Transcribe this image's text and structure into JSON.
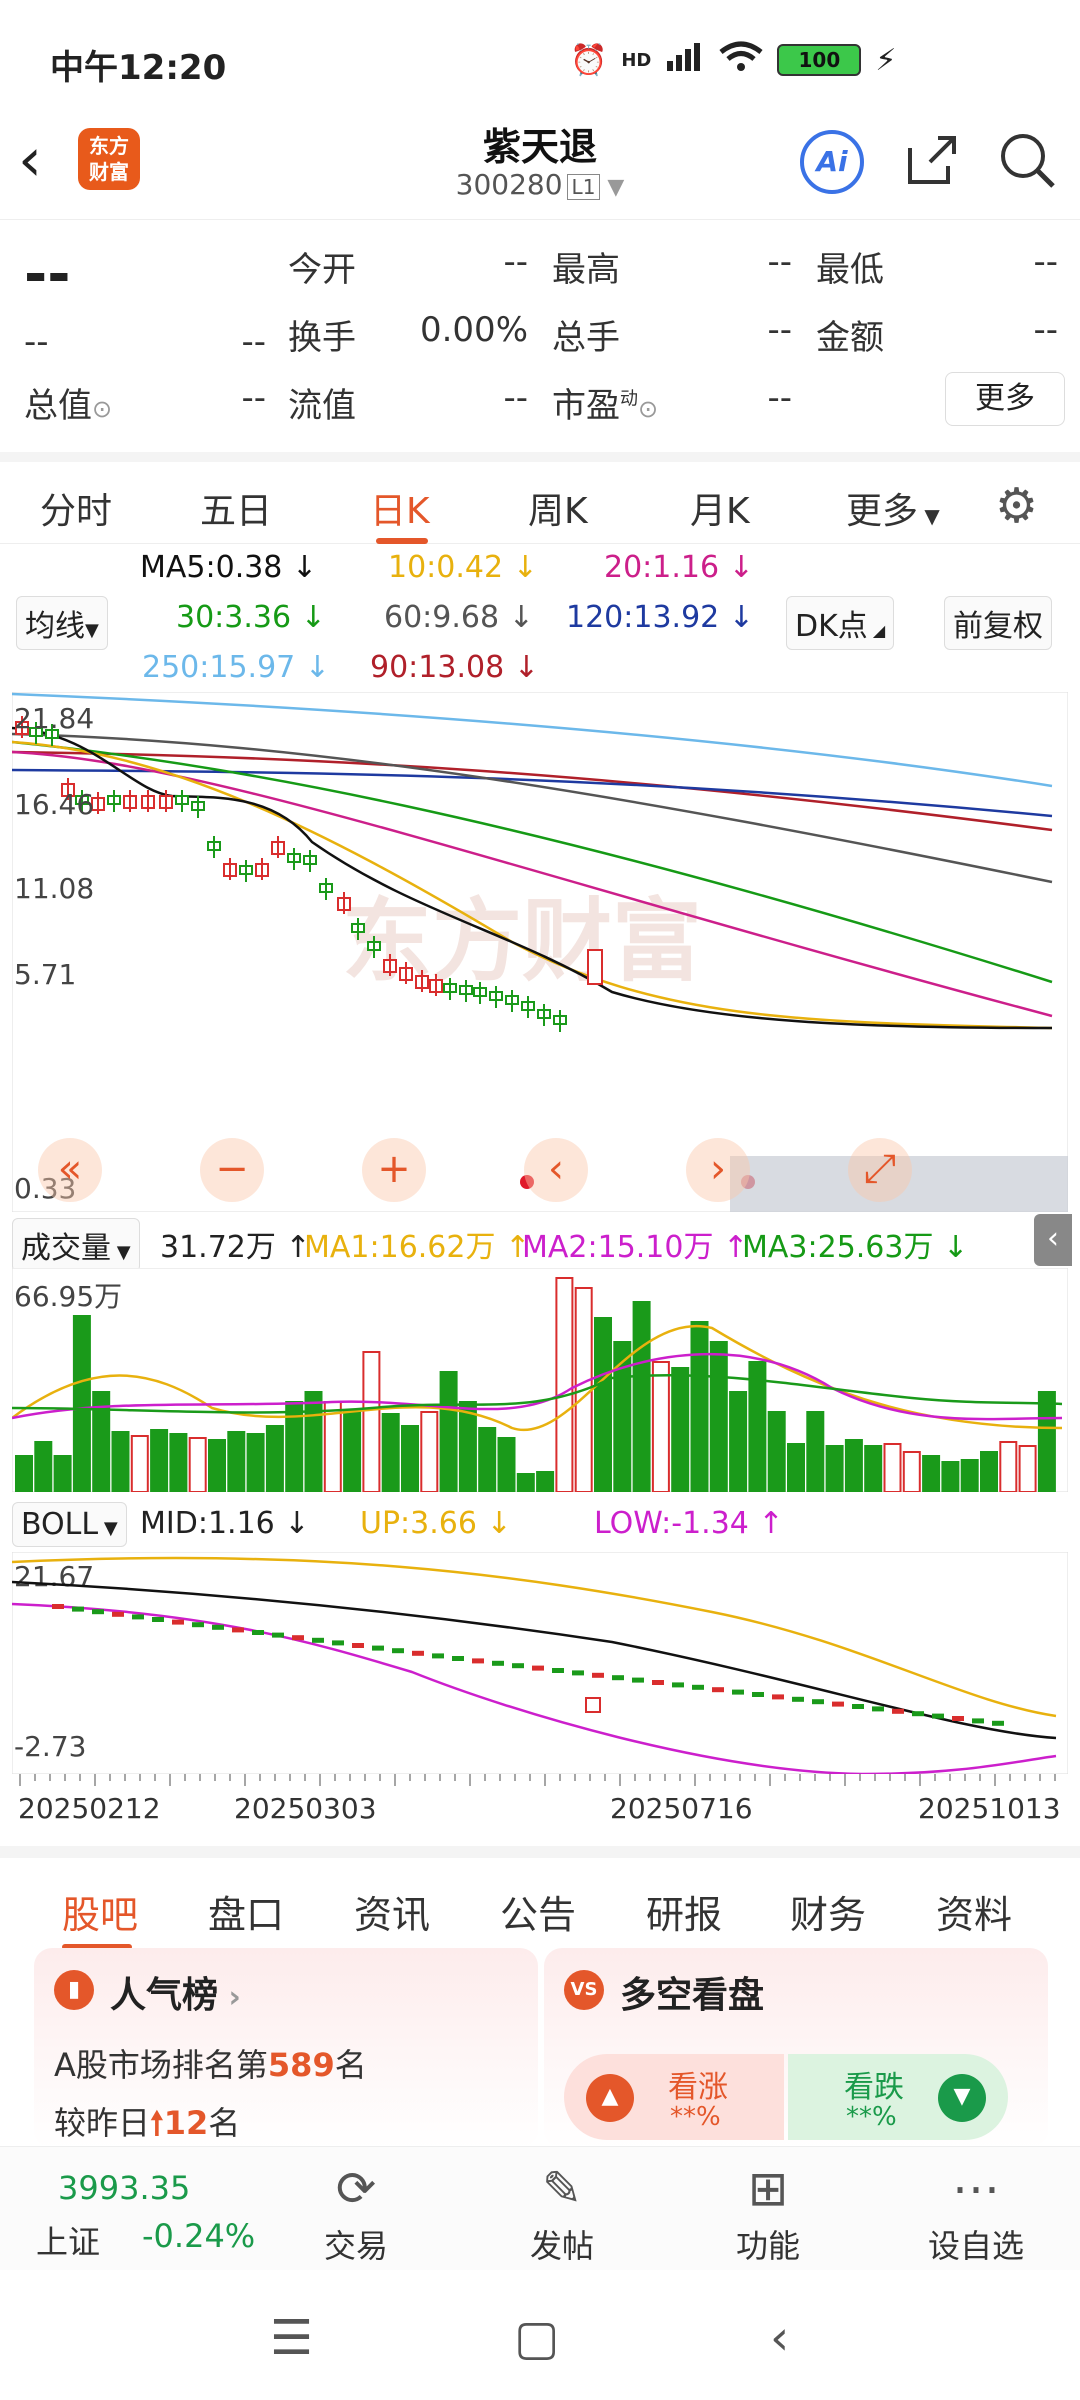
{
  "status": {
    "time": "中午12:20",
    "battery": "100",
    "hd": "HD"
  },
  "header": {
    "back": "‹",
    "logo_text": "东方\n财富",
    "title": "紫天退",
    "code": "300280",
    "level": "L1",
    "ai": "Ai"
  },
  "quote": {
    "price": "--",
    "change": "--",
    "change_pct": "--",
    "cells": [
      {
        "label": "今开",
        "value": "--"
      },
      {
        "label": "最高",
        "value": "--"
      },
      {
        "label": "最低",
        "value": "--"
      },
      {
        "label": "换手",
        "value": "0.00%"
      },
      {
        "label": "总手",
        "value": "--"
      },
      {
        "label": "金额",
        "value": "--"
      },
      {
        "label": "总值",
        "value": "--"
      },
      {
        "label": "流值",
        "value": "--"
      },
      {
        "label": "市盈",
        "value": "--"
      }
    ],
    "pe_note": "动",
    "more": "更多"
  },
  "period_tabs": [
    "分时",
    "五日",
    "日K",
    "周K",
    "月K",
    "更多"
  ],
  "active_period": "日K",
  "ma": {
    "selector": "均线",
    "dk": "DK点",
    "adjust": "前复权",
    "ma5": "MA5:0.38 ↓",
    "ma10": "10:0.42 ↓",
    "ma20": "20:1.16 ↓",
    "ma30": "30:3.36 ↓",
    "ma60": "60:9.68 ↓",
    "ma120": "120:13.92 ↓",
    "ma250": "250:15.97 ↓",
    "ma90": "90:13.08 ↓"
  },
  "kline": {
    "y_ticks": [
      "21.84",
      "16.46",
      "11.08",
      "5.71",
      "0.33"
    ],
    "watermark": "东方财富"
  },
  "volume": {
    "selector": "成交量",
    "vol": "31.72万 ↑",
    "ma1": "MA1:16.62万 ↑",
    "ma2": "MA2:15.10万 ↑",
    "ma3": "MA3:25.63万 ↓",
    "max_label": "66.95万"
  },
  "boll": {
    "selector": "BOLL",
    "mid": "MID:1.16 ↓",
    "up": "UP:3.66 ↓",
    "low": "LOW:-1.34 ↑",
    "top_label": "21.67",
    "bottom_label": "-2.73"
  },
  "dates": [
    "20250212",
    "20250303",
    "20250716",
    "20251013"
  ],
  "bottom_tabs": [
    "股吧",
    "盘口",
    "资讯",
    "公告",
    "研报",
    "财务",
    "资料"
  ],
  "cards": {
    "popular": {
      "title": "人气榜",
      "line1_prefix": "A股市场排名第",
      "line1_num": "589",
      "line1_suffix": "名",
      "line2_prefix": "较昨日",
      "line2_num": "12",
      "line2_suffix": "名"
    },
    "bullbear": {
      "title": "多空看盘",
      "bull_label": "看涨",
      "bull_value": "**%",
      "bear_label": "看跌",
      "bear_value": "**%"
    }
  },
  "footer": {
    "index_value": "3993.35",
    "index_name": "上证",
    "index_change": "-0.24%",
    "items": [
      "交易",
      "发帖",
      "功能",
      "设自选"
    ]
  },
  "colors": {
    "accent": "#e4572a",
    "up_red": "#d92d2d",
    "down_green": "#1a9a1a",
    "ma5": "#111111",
    "ma10": "#e8b10e",
    "ma20": "#cc1f8a",
    "ma30": "#169a16",
    "ma60": "#555555",
    "ma120": "#1e3aa0",
    "ma250": "#6cb8ea",
    "ma90": "#b0202a"
  }
}
